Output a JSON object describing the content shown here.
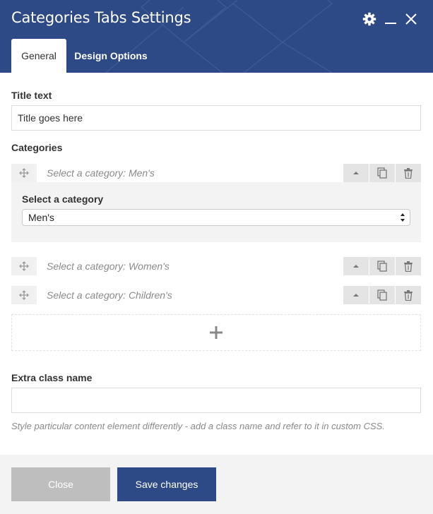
{
  "window": {
    "title": "Categories Tabs Settings",
    "icons": [
      "gear-icon",
      "minimize-icon",
      "close-icon"
    ]
  },
  "tabs": [
    {
      "label": "General",
      "active": true
    },
    {
      "label": "Design Options",
      "active": false
    }
  ],
  "title_field": {
    "label": "Title text",
    "value": "Title goes here"
  },
  "categories": {
    "label": "Categories",
    "items": [
      {
        "header": "Select a category: Men's",
        "expanded": true,
        "field_label": "Select a category",
        "selected": "Men's"
      },
      {
        "header": "Select a category: Women's",
        "expanded": false
      },
      {
        "header": "Select a category: Children's",
        "expanded": false
      }
    ]
  },
  "extra_class": {
    "label": "Extra class name",
    "value": "",
    "help": "Style particular content element differently - add a class name and refer to it in custom CSS."
  },
  "footer": {
    "close_label": "Close",
    "save_label": "Save changes"
  },
  "colors": {
    "header": "#2d4a86",
    "save_button": "#2d4a86",
    "close_button": "#bebebe"
  }
}
